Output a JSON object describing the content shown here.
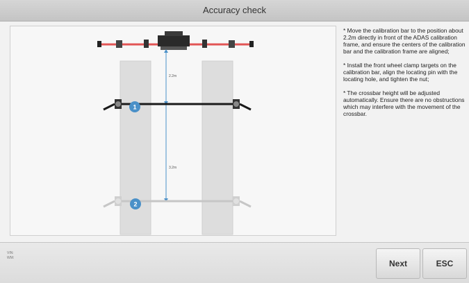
{
  "header": {
    "title": "Accuracy check"
  },
  "diagram": {
    "distance_top_label": "2.2m",
    "distance_bottom_label": "3.2m",
    "position_1_label": "1",
    "position_2_label": "2",
    "colors": {
      "frame_bar": "#e25555",
      "position_marker": "#4a90c8",
      "guide_line": "#4a90c8",
      "active_bar": "#1a1a1a",
      "inactive_bar": "#c6c6c6",
      "wheel_strip": "#dddddd"
    }
  },
  "instructions": [
    "* Move the calibration bar to the position about 2.2m directly in front of the ADAS calibration frame, and ensure the centers of the calibration bar and the calibration frame are aligned;",
    "* Install the front wheel clamp targets on the calibration bar, align the locating pin with the locating hole, and tighten the nut;",
    "* The crossbar height will be adjusted automatically. Ensure there are no obstructions which may interfere with the movement of the crossbar."
  ],
  "footer": {
    "vin_label": "VIN:",
    "info_label": "WM:",
    "next_label": "Next",
    "esc_label": "ESC"
  }
}
